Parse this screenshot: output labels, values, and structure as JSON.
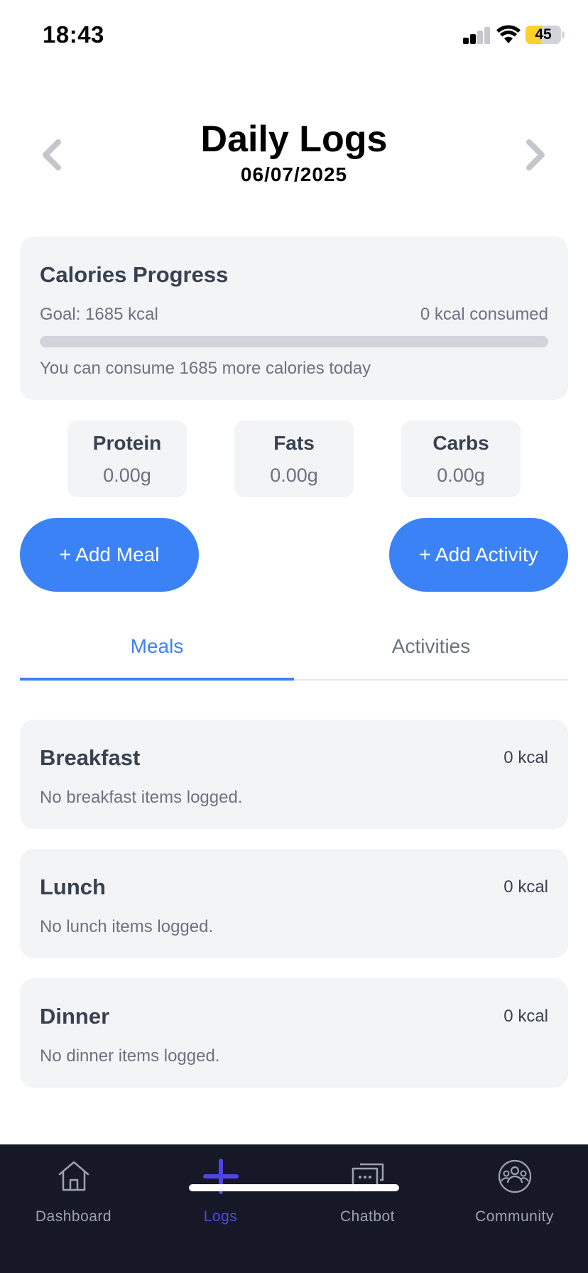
{
  "status_bar": {
    "time": "18:43",
    "battery_level": "45",
    "battery_fraction": 0.45,
    "icons": [
      "signal-icon",
      "wifi-icon",
      "battery-icon"
    ]
  },
  "header": {
    "title": "Daily Logs",
    "date": "06/07/2025",
    "prev_icon": "chevron-left-icon",
    "next_icon": "chevron-right-icon"
  },
  "calories": {
    "title": "Calories Progress",
    "goal": "Goal: 1685 kcal",
    "consumed": "0 kcal consumed",
    "progress_fraction": 0,
    "remaining": "You can consume 1685 more calories today"
  },
  "macros": {
    "protein": {
      "label": "Protein",
      "value": "0.00g"
    },
    "fats": {
      "label": "Fats",
      "value": "0.00g"
    },
    "carbs": {
      "label": "Carbs",
      "value": "0.00g"
    }
  },
  "actions": {
    "add_meal": "+ Add Meal",
    "add_activity": "+ Add Activity"
  },
  "tabs": {
    "meals": "Meals",
    "activities": "Activities",
    "active": "meals"
  },
  "meals": {
    "breakfast": {
      "name": "Breakfast",
      "kcal": "0 kcal",
      "empty": "No breakfast items logged."
    },
    "lunch": {
      "name": "Lunch",
      "kcal": "0 kcal",
      "empty": "No lunch items logged."
    },
    "dinner": {
      "name": "Dinner",
      "kcal": "0 kcal",
      "empty": "No dinner items logged."
    }
  },
  "tabbar": {
    "items": [
      {
        "label": "Dashboard",
        "icon": "home-icon"
      },
      {
        "label": "Logs",
        "icon": "plus-icon"
      },
      {
        "label": "Chatbot",
        "icon": "chat-icon"
      },
      {
        "label": "Community",
        "icon": "community-icon"
      }
    ],
    "active_index": 1
  },
  "colors": {
    "accent": "#3b82f6",
    "active_tab": "#4f46e5",
    "tabbar_bg": "#161827",
    "card_bg": "#f3f4f6",
    "battery": "#fcd228"
  }
}
